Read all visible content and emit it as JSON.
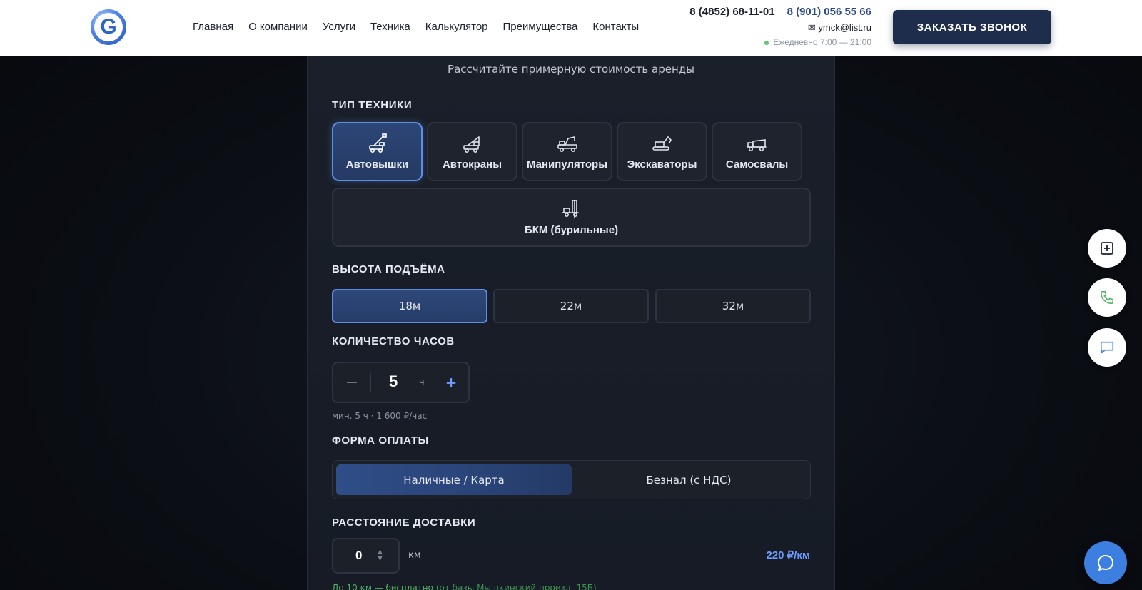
{
  "header": {
    "logo_letter": "G",
    "nav": [
      "Главная",
      "О компании",
      "Услуги",
      "Техника",
      "Калькулятор",
      "Преимущества",
      "Контакты"
    ],
    "phone1": "8 (4852) 68-11-01",
    "phone2": "8 (901) 056 55 66",
    "email": "✉ ymck@list.ru",
    "hours": "Ежедневно 7:00 — 21:00",
    "callback_label": "ЗАКАЗАТЬ ЗВОНОК"
  },
  "calculator": {
    "subtitle": "Рассчитайте примерную стоимость аренды",
    "type_label": "ТИП ТЕХНИКИ",
    "types": [
      {
        "label": "Автовышки",
        "icon": "aerial-platform-icon",
        "active": true
      },
      {
        "label": "Автокраны",
        "icon": "truck-crane-icon",
        "active": false
      },
      {
        "label": "Манипуляторы",
        "icon": "manipulator-icon",
        "active": false
      },
      {
        "label": "Экскаваторы",
        "icon": "excavator-icon",
        "active": false
      },
      {
        "label": "Самосвалы",
        "icon": "dump-truck-icon",
        "active": false
      },
      {
        "label": "БКМ (бурильные)",
        "icon": "drilling-rig-icon",
        "active": false
      }
    ],
    "height_label": "ВЫСОТА ПОДЪЁМА",
    "heights": [
      {
        "label": "18м",
        "active": true
      },
      {
        "label": "22м",
        "active": false
      },
      {
        "label": "32м",
        "active": false
      }
    ],
    "hours_label": "КОЛИЧЕСТВО ЧАСОВ",
    "hours_value": "5",
    "hours_unit": "ч",
    "minus": "−",
    "plus": "+",
    "hours_hint": "мин. 5 ч  ·  1 600 ₽/час",
    "payment_label": "ФОРМА ОПЛАТЫ",
    "payment_options": [
      {
        "label": "Наличные / Карта",
        "active": true
      },
      {
        "label": "Безнал (с НДС)",
        "active": false
      }
    ],
    "distance_label": "РАССТОЯНИЕ ДОСТАВКИ",
    "distance_value": "0",
    "distance_unit": "км",
    "distance_price": "220 ₽/км",
    "free_note_main": "До 10 км — бесплатно",
    "free_note_extra": "(от базы Мышкинский проезд, 15Б)"
  },
  "side_actions": [
    {
      "icon": "plus-square-icon"
    },
    {
      "icon": "phone-icon"
    },
    {
      "icon": "message-icon"
    }
  ],
  "chat_icon": "chat-bubble-icon",
  "colors": {
    "accent": "#5c8ee6",
    "brand_dark": "#1e2d4c",
    "price_blue": "#6e9cff",
    "free_green": "#4cb15f"
  }
}
